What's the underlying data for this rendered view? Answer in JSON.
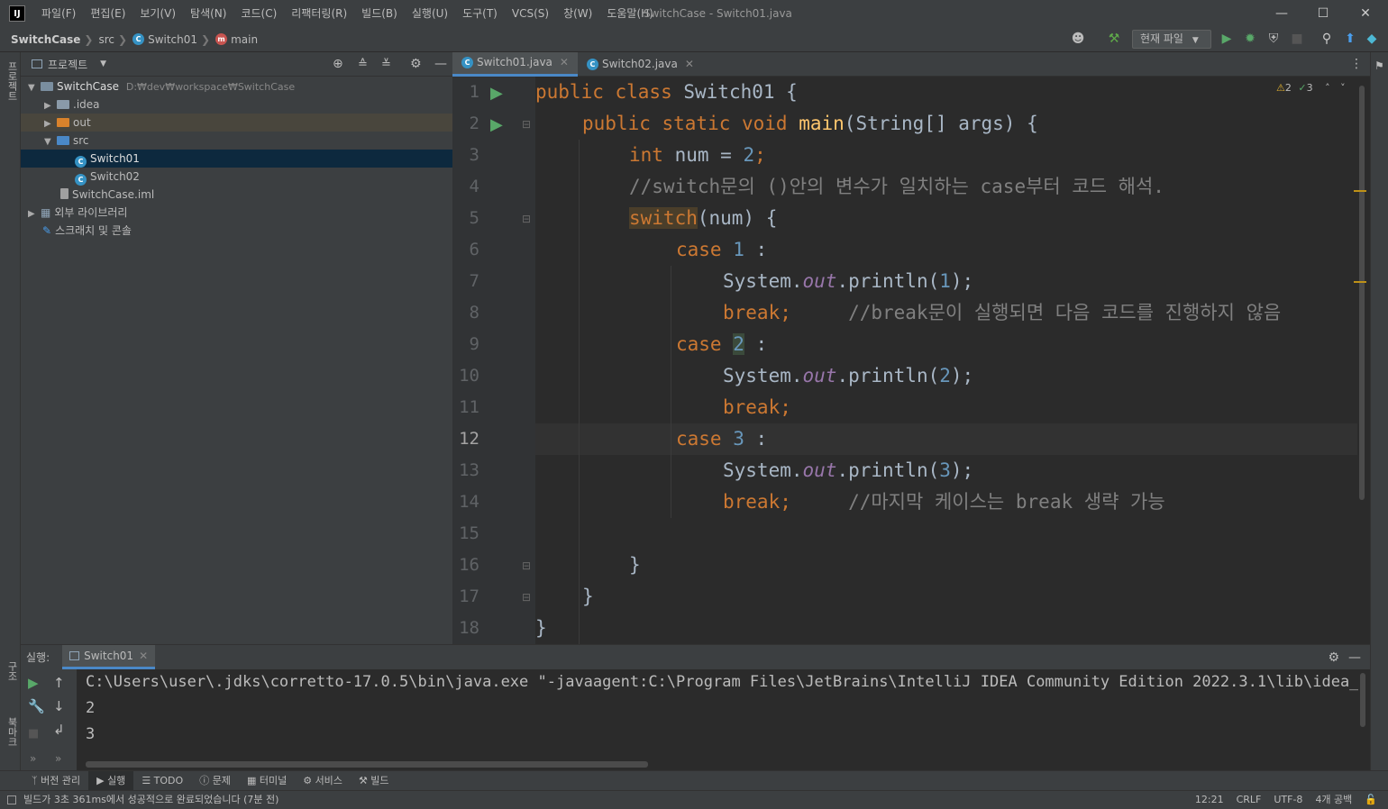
{
  "menu": [
    "파일(F)",
    "편집(E)",
    "보기(V)",
    "탐색(N)",
    "코드(C)",
    "리팩터링(R)",
    "빌드(B)",
    "실행(U)",
    "도구(T)",
    "VCS(S)",
    "창(W)",
    "도움말(H)"
  ],
  "window_title": "SwitchCase - Switch01.java",
  "breadcrumb": [
    "SwitchCase",
    "src",
    "Switch01",
    "main"
  ],
  "run_config": "현재 파일",
  "left_strip": [
    "프로젝트",
    "구조",
    "북마크"
  ],
  "project": {
    "header": "프로젝트",
    "root_name": "SwitchCase",
    "root_path": "D:₩dev₩workspace₩SwitchCase",
    "items": [
      ".idea",
      "out",
      "src",
      "Switch01",
      "Switch02",
      "SwitchCase.iml",
      "외부 라이브러리",
      "스크래치 및 콘솔"
    ]
  },
  "tabs": [
    "Switch01.java",
    "Switch02.java"
  ],
  "inspections": {
    "warnings": "2",
    "weak_warnings": "3"
  },
  "line_numbers": [
    "1",
    "2",
    "3",
    "4",
    "5",
    "6",
    "7",
    "8",
    "9",
    "10",
    "11",
    "12",
    "13",
    "14",
    "15",
    "16",
    "17",
    "18"
  ],
  "code": {
    "l1": {
      "a": "public class ",
      "b": "Switch01 {"
    },
    "l2": {
      "a": "public static void ",
      "b": "main",
      "c": "(String[] args) {"
    },
    "l3": {
      "a": "int ",
      "b": "num = ",
      "c": "2",
      "d": ";"
    },
    "l4": "//switch문의 ()안의 변수가 일치하는 case부터 코드 해석.",
    "l5": {
      "a": "switch",
      "b": "(num) {"
    },
    "l6": {
      "a": "case ",
      "b": "1",
      "c": " :"
    },
    "l7": {
      "a": "System.",
      "b": "out",
      "c": ".println(",
      "d": "1",
      "e": ");"
    },
    "l8": {
      "a": "break;",
      "b": "     //break문이 실행되면 다음 코드를 진행하지 않음"
    },
    "l9": {
      "a": "case ",
      "b": "2",
      "c": " :"
    },
    "l10": {
      "a": "System.",
      "b": "out",
      "c": ".println(",
      "d": "2",
      "e": ");"
    },
    "l11": {
      "a": "break;"
    },
    "l12": {
      "a": "case ",
      "b": "3",
      "c": " :"
    },
    "l13": {
      "a": "System.",
      "b": "out",
      "c": ".println(",
      "d": "3",
      "e": ");"
    },
    "l14": {
      "a": "break;",
      "b": "     //마지막 케이스는 break 생략 가능"
    },
    "l16": "}",
    "l17": "}",
    "l18": "}"
  },
  "run": {
    "label": "실행:",
    "tab": "Switch01",
    "output": [
      "C:\\Users\\user\\.jdks\\corretto-17.0.5\\bin\\java.exe \"-javaagent:C:\\Program Files\\JetBrains\\IntelliJ IDEA Community Edition 2022.3.1\\lib\\idea_rt.j",
      "2",
      "3"
    ]
  },
  "tool_strip": [
    "버전 관리",
    "실행",
    "TODO",
    "문제",
    "터미널",
    "서비스",
    "빌드"
  ],
  "status": {
    "message": "빌드가 3초 361ms에서 성공적으로 완료되었습니다 (7분 전)",
    "position": "12:21",
    "line_ending": "CRLF",
    "encoding": "UTF-8",
    "indent": "4개 공백"
  },
  "colors": {
    "keyword": "#cc7832",
    "number": "#6897bb",
    "method": "#ffc66d",
    "comment": "#808080",
    "static_field": "#9876aa",
    "accent": "#4a88c7"
  }
}
